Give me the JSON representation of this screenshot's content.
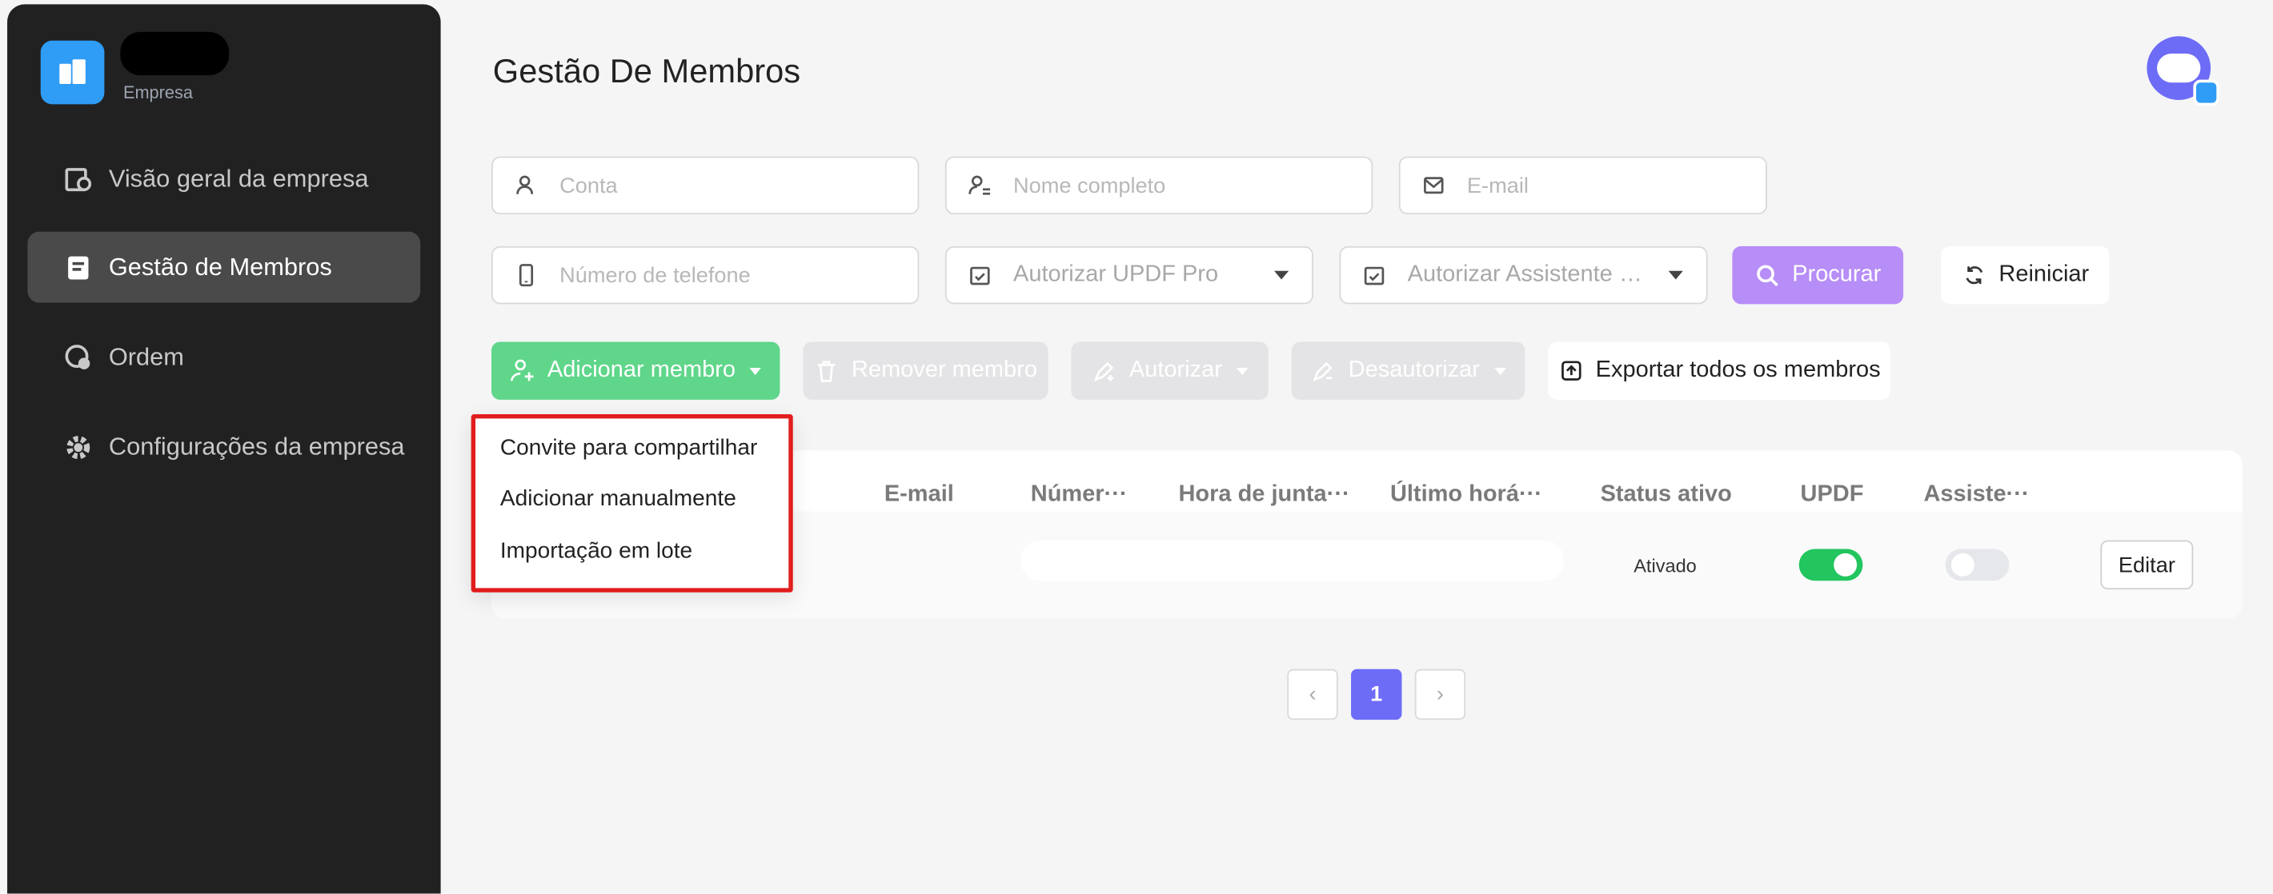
{
  "sidebar": {
    "logo_subtitle": "Empresa",
    "items": [
      {
        "label": "Visão geral da empresa",
        "icon": "overview-icon"
      },
      {
        "label": "Gestão de Membros",
        "icon": "members-icon"
      },
      {
        "label": "Ordem",
        "icon": "order-icon"
      },
      {
        "label": "Configurações da empresa",
        "icon": "settings-icon"
      }
    ]
  },
  "header": {
    "title": "Gestão De Membros"
  },
  "filters": {
    "account_placeholder": "Conta",
    "fullname_placeholder": "Nome completo",
    "email_placeholder": "E-mail",
    "phone_placeholder": "Número de telefone",
    "authorize_pro_select": "Autorizar UPDF Pro",
    "authorize_assistant_select": "Autorizar Assistente …",
    "search_label": "Procurar",
    "reset_label": "Reiniciar"
  },
  "actions": {
    "add_member": "Adicionar membro",
    "remove_member": "Remover membro",
    "authorize": "Autorizar",
    "deauthorize": "Desautorizar",
    "export_all": "Exportar todos os membros"
  },
  "add_member_menu": {
    "items": [
      "Convite para compartilhar",
      "Adicionar manualmente",
      "Importação em lote"
    ]
  },
  "table": {
    "headers": [
      "E-mail",
      "Númer···",
      "Hora de junta···",
      "Último horá···",
      "Status ativo",
      "UPDF",
      "Assiste···"
    ],
    "rows": [
      {
        "status": "Ativado",
        "updf_enabled": true,
        "assistant_enabled": false,
        "edit_label": "Editar"
      }
    ]
  },
  "pagination": {
    "current_page": "1",
    "prev_symbol": "‹",
    "next_symbol": "›"
  },
  "colors": {
    "accent_purple": "#6d6cf7",
    "search_purple": "#b78df7",
    "add_green": "#5fd68a",
    "toggle_green": "#22c55e",
    "sidebar_bg": "#212121",
    "highlight_red": "#e11d1d"
  }
}
